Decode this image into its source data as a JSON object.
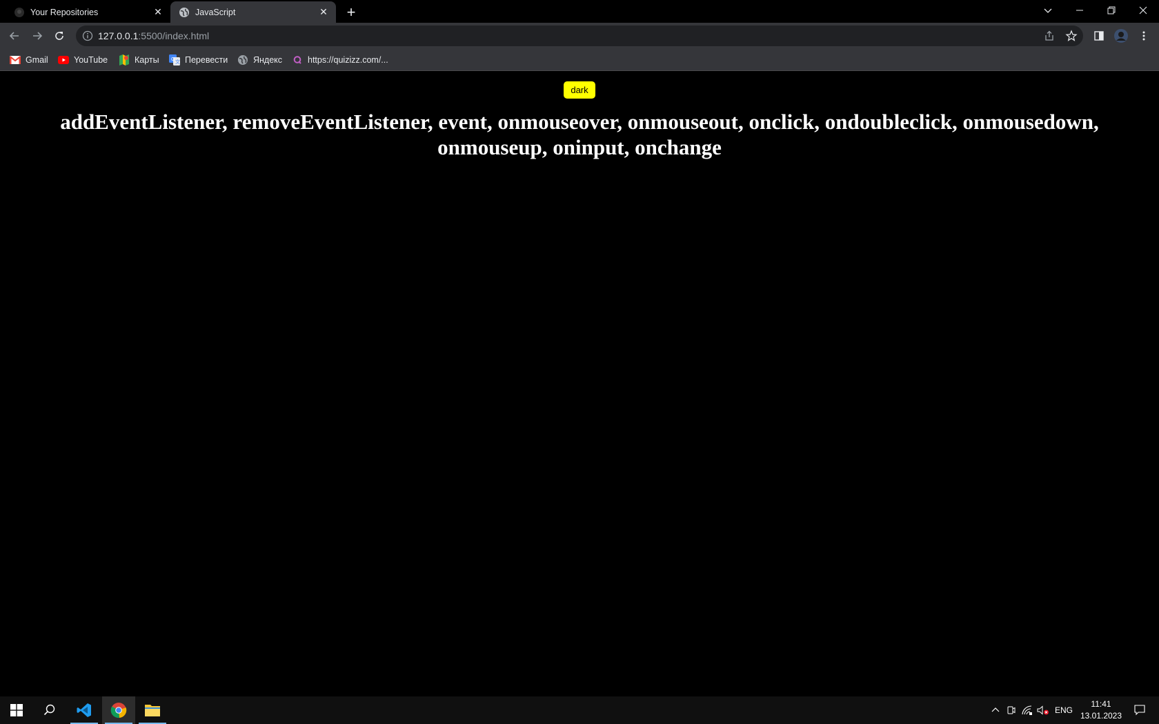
{
  "tabs": [
    {
      "title": "Your Repositories",
      "active": false,
      "icon": "github-icon"
    },
    {
      "title": "JavaScript",
      "active": true,
      "icon": "globe-icon"
    }
  ],
  "address_bar": {
    "host": "127.0.0.1",
    "path": ":5500/index.html"
  },
  "bookmarks": [
    {
      "label": "Gmail",
      "icon": "gmail-icon"
    },
    {
      "label": "YouTube",
      "icon": "youtube-icon"
    },
    {
      "label": "Карты",
      "icon": "maps-icon"
    },
    {
      "label": "Перевести",
      "icon": "translate-icon"
    },
    {
      "label": "Яндекс",
      "icon": "globe-icon"
    },
    {
      "label": "https://quizizz.com/...",
      "icon": "quizizz-icon"
    }
  ],
  "page": {
    "button_label": "dark",
    "heading": "addEventListener, removeEventListener, event, onmouseover, onmouseout, onclick, ondoubleclick, onmousedown, onmouseup, oninput, onchange"
  },
  "taskbar": {
    "language": "ENG",
    "time": "11:41",
    "date": "13.01.2023"
  },
  "colors": {
    "button_bg": "#ffff00",
    "page_bg": "#000000",
    "heading": "#ffffff"
  }
}
